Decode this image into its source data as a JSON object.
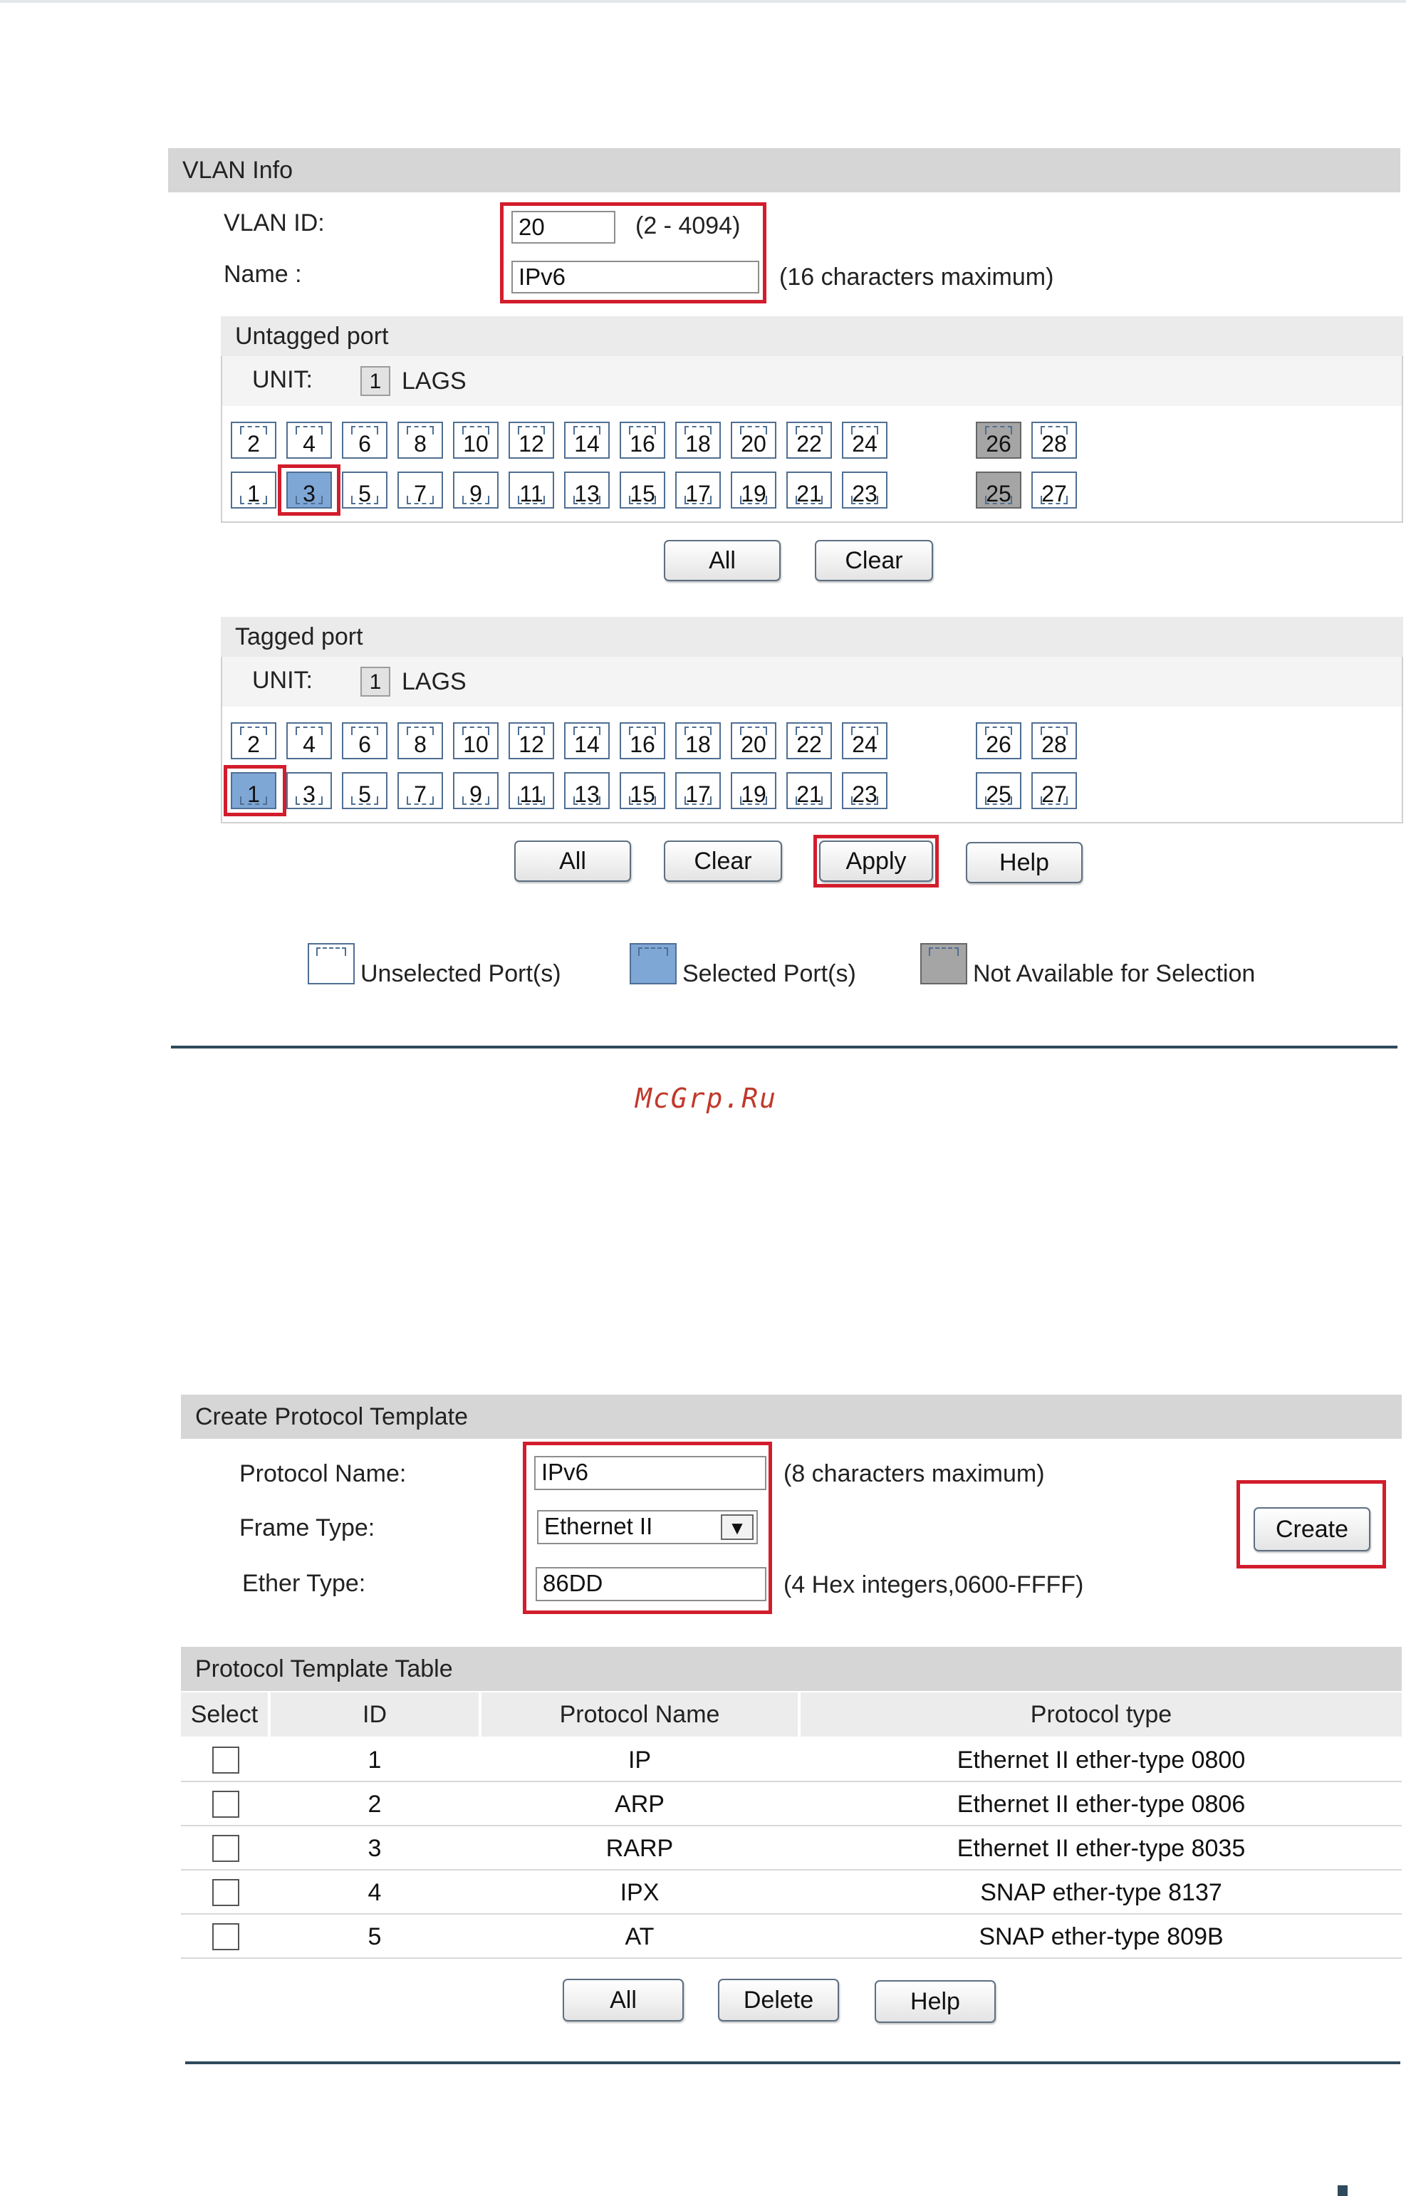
{
  "vlan_info": {
    "header": "VLAN Info",
    "vlan_id_label": "VLAN ID:",
    "vlan_id_value": "20",
    "vlan_id_range": "(2 - 4094)",
    "name_label": "Name :",
    "name_value": "IPv6",
    "name_hint": "(16 characters maximum)"
  },
  "untagged": {
    "header": "Untagged port",
    "unit_label": "UNIT:",
    "unit_value": "1",
    "lags_label": "LAGS",
    "top_row": [
      "2",
      "4",
      "6",
      "8",
      "10",
      "12",
      "14",
      "16",
      "18",
      "20",
      "22",
      "24"
    ],
    "bottom_row": [
      "1",
      "3",
      "5",
      "7",
      "9",
      "11",
      "13",
      "15",
      "17",
      "19",
      "21",
      "23"
    ],
    "top_extra": [
      "26",
      "28"
    ],
    "bottom_extra": [
      "25",
      "27"
    ],
    "all_label": "All",
    "clear_label": "Clear"
  },
  "tagged": {
    "header": "Tagged port",
    "unit_label": "UNIT:",
    "unit_value": "1",
    "lags_label": "LAGS",
    "top_row": [
      "2",
      "4",
      "6",
      "8",
      "10",
      "12",
      "14",
      "16",
      "18",
      "20",
      "22",
      "24"
    ],
    "bottom_row": [
      "1",
      "3",
      "5",
      "7",
      "9",
      "11",
      "13",
      "15",
      "17",
      "19",
      "21",
      "23"
    ],
    "top_extra": [
      "26",
      "28"
    ],
    "bottom_extra": [
      "25",
      "27"
    ],
    "all_label": "All",
    "clear_label": "Clear",
    "apply_label": "Apply",
    "help_label": "Help"
  },
  "legend": {
    "unselected": "Unselected Port(s)",
    "selected": "Selected Port(s)",
    "not_available": "Not Available for Selection"
  },
  "watermark": "McGrp.Ru",
  "protocol_template": {
    "header": "Create Protocol Template",
    "name_label": "Protocol Name:",
    "name_value": "IPv6",
    "name_hint": "(8 characters maximum)",
    "frame_label": "Frame Type:",
    "frame_value": "Ethernet II",
    "ether_label": "Ether Type:",
    "ether_value": "86DD",
    "ether_hint": "(4 Hex integers,0600-FFFF)",
    "create_label": "Create"
  },
  "template_table": {
    "header": "Protocol Template Table",
    "columns": [
      "Select",
      "ID",
      "Protocol Name",
      "Protocol type"
    ],
    "rows": [
      {
        "id": "1",
        "name": "IP",
        "type": "Ethernet II ether-type 0800"
      },
      {
        "id": "2",
        "name": "ARP",
        "type": "Ethernet II ether-type 0806"
      },
      {
        "id": "3",
        "name": "RARP",
        "type": "Ethernet II ether-type 8035"
      },
      {
        "id": "4",
        "name": "IPX",
        "type": "SNAP ether-type 8137"
      },
      {
        "id": "5",
        "name": "AT",
        "type": "SNAP ether-type 809B"
      }
    ],
    "all_label": "All",
    "delete_label": "Delete",
    "help_label": "Help"
  },
  "colors": {
    "selected_port": "#7fa7d6",
    "unavailable_port": "#a5a5a5",
    "highlight_red": "#d21d2c",
    "divider": "#2f4a5c"
  }
}
